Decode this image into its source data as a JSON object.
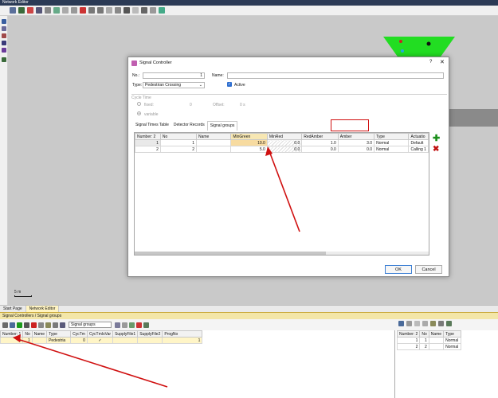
{
  "window": {
    "title": "Network Editor"
  },
  "canvas": {
    "scale_label": "5 m"
  },
  "bottom_tabs": [
    {
      "label": "Start Page"
    },
    {
      "label": "Network Editor"
    }
  ],
  "lower_panel": {
    "title": "Signal Controllers / Signal groups",
    "select_value": "Signal groups",
    "left_table": {
      "headers": [
        "Number: 1",
        "No",
        "Name",
        "Type",
        "CycTm",
        "CycTmIsVar",
        "SupplyFile1",
        "SupplyFile2",
        "ProgNo"
      ],
      "rows": [
        {
          "count": "1",
          "no": "1",
          "name": "",
          "type": "Pedestria",
          "cyctm": "0",
          "cyctmvar": "✓",
          "supply1": "",
          "supply2": "",
          "progno": "1"
        }
      ]
    },
    "right_table": {
      "headers": [
        "Number: 2",
        "No",
        "Name",
        "Type"
      ],
      "rows": [
        {
          "count": "1",
          "no": "1",
          "name": "",
          "type": "Normal"
        },
        {
          "count": "2",
          "no": "2",
          "name": "",
          "type": "Normal"
        }
      ]
    }
  },
  "dialog": {
    "title": "Signal Controller",
    "help": "?",
    "close": "✕",
    "no_label": "No.:",
    "no_value": "1",
    "name_label": "Name:",
    "name_value": "",
    "type_label": "Type:",
    "type_value": "Pedestrian Crossing",
    "active_label": "Active",
    "cycle_time_label": "Cycle Time",
    "fixed_label": "fixed:",
    "fixed_value": "0",
    "offset_label": "Offset:",
    "offset_value": "0 s",
    "variable_label": "variable",
    "tabs": [
      {
        "label": "Signal Times Table"
      },
      {
        "label": "Detector Records"
      },
      {
        "label": "Signal groups"
      }
    ],
    "grid": {
      "headers": [
        "Number: 2",
        "No",
        "Name",
        "MinGreen",
        "MinRed",
        "RedAmber",
        "Amber",
        "Type",
        "Actuatio"
      ],
      "rows": [
        {
          "count": "1",
          "no": "1",
          "name": "",
          "mingreen": "10.0",
          "minred": "0.0",
          "redamber": "1.0",
          "amber": "3.0",
          "type": "Normal",
          "actuation": "Default"
        },
        {
          "count": "2",
          "no": "2",
          "name": "",
          "mingreen": "5.0",
          "minred": "0.0",
          "redamber": "0.0",
          "amber": "0.0",
          "type": "Normal",
          "actuation": "Calling 1"
        }
      ]
    },
    "ok_label": "OK",
    "cancel_label": "Cancel"
  },
  "colors": {
    "annotation_red": "#d01010",
    "panel_header": "#f3e6a8",
    "funnel_green": "#22dd22"
  }
}
